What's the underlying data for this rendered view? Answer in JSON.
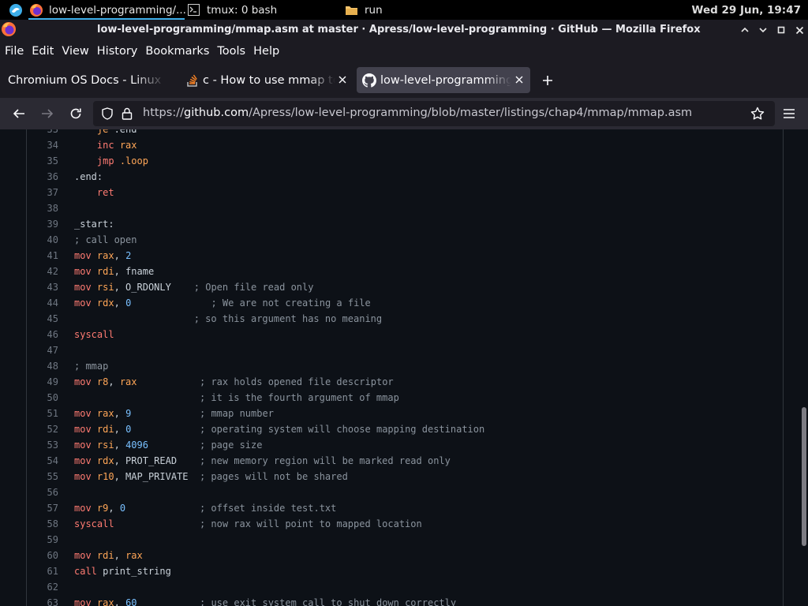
{
  "taskbar": {
    "apps": [
      {
        "label": "low-level-programming/...",
        "icon": "firefox-icon"
      },
      {
        "label": "tmux: 0 bash",
        "icon": "terminal-icon"
      },
      {
        "label": "run",
        "icon": "folder-icon"
      }
    ],
    "clock": "Wed 29 Jun, 19:47"
  },
  "window": {
    "title": "low-level-programming/mmap.asm at master · Apress/low-level-programming · GitHub — Mozilla Firefox"
  },
  "menu": {
    "items": [
      "File",
      "Edit",
      "View",
      "History",
      "Bookmarks",
      "Tools",
      "Help"
    ]
  },
  "tabs": [
    {
      "label": "Chromium OS Docs - Linux System Call Table",
      "icon": "",
      "active": false
    },
    {
      "label": "c - How to use mmap to allocate a memory",
      "icon": "stackoverflow-icon",
      "active": false
    },
    {
      "label": "low-level-programming/mmap.asm",
      "icon": "github-icon",
      "active": true
    }
  ],
  "navbar": {
    "url_prefix": "https://",
    "url_host": "github.com",
    "url_path": "/Apress/low-level-programming/blob/master/listings/chap4/mmap/mmap.asm"
  },
  "code": {
    "lines": [
      {
        "n": "33",
        "tokens": [
          [
            "    ",
            ""
          ],
          [
            "je",
            "ctrl"
          ],
          [
            " .end",
            "id"
          ]
        ]
      },
      {
        "n": "34",
        "tokens": [
          [
            "    ",
            ""
          ],
          [
            "inc",
            "kw"
          ],
          [
            " ",
            ""
          ],
          [
            "rax",
            "reg"
          ]
        ]
      },
      {
        "n": "35",
        "tokens": [
          [
            "    ",
            ""
          ],
          [
            "jmp",
            "kw"
          ],
          [
            " .loop",
            "ctrl"
          ]
        ]
      },
      {
        "n": "36",
        "tokens": [
          [
            ".end:",
            "id"
          ]
        ]
      },
      {
        "n": "37",
        "tokens": [
          [
            "    ",
            ""
          ],
          [
            "ret",
            "kw"
          ]
        ]
      },
      {
        "n": "38",
        "tokens": []
      },
      {
        "n": "39",
        "tokens": [
          [
            "_start:",
            "id"
          ]
        ]
      },
      {
        "n": "40",
        "tokens": [
          [
            "; call open",
            "cm"
          ]
        ]
      },
      {
        "n": "41",
        "tokens": [
          [
            "mov",
            "kw"
          ],
          [
            " ",
            ""
          ],
          [
            "rax",
            "reg"
          ],
          [
            ", ",
            "id"
          ],
          [
            "2",
            "num"
          ]
        ]
      },
      {
        "n": "42",
        "tokens": [
          [
            "mov",
            "kw"
          ],
          [
            " ",
            ""
          ],
          [
            "rdi",
            "reg"
          ],
          [
            ", fname",
            "id"
          ]
        ]
      },
      {
        "n": "43",
        "tokens": [
          [
            "mov",
            "kw"
          ],
          [
            " ",
            ""
          ],
          [
            "rsi",
            "reg"
          ],
          [
            ", O_RDONLY    ",
            "id"
          ],
          [
            "; Open file read only",
            "cm"
          ]
        ]
      },
      {
        "n": "44",
        "tokens": [
          [
            "mov",
            "kw"
          ],
          [
            " ",
            ""
          ],
          [
            "rdx",
            "reg"
          ],
          [
            ", ",
            "id"
          ],
          [
            "0",
            "num"
          ],
          [
            "              ",
            ""
          ],
          [
            "; We are not creating a file",
            "cm"
          ]
        ]
      },
      {
        "n": "45",
        "tokens": [
          [
            "                     ",
            ""
          ],
          [
            "; so this argument has no meaning",
            "cm"
          ]
        ]
      },
      {
        "n": "46",
        "tokens": [
          [
            "syscall",
            "kw"
          ]
        ]
      },
      {
        "n": "47",
        "tokens": []
      },
      {
        "n": "48",
        "tokens": [
          [
            "; mmap",
            "cm"
          ]
        ]
      },
      {
        "n": "49",
        "tokens": [
          [
            "mov",
            "kw"
          ],
          [
            " ",
            ""
          ],
          [
            "r8",
            "reg"
          ],
          [
            ", ",
            "id"
          ],
          [
            "rax",
            "reg"
          ],
          [
            "           ",
            ""
          ],
          [
            "; rax holds opened file descriptor",
            "cm"
          ]
        ]
      },
      {
        "n": "50",
        "tokens": [
          [
            "                      ",
            ""
          ],
          [
            "; it is the fourth argument of mmap",
            "cm"
          ]
        ]
      },
      {
        "n": "51",
        "tokens": [
          [
            "mov",
            "kw"
          ],
          [
            " ",
            ""
          ],
          [
            "rax",
            "reg"
          ],
          [
            ", ",
            "id"
          ],
          [
            "9",
            "num"
          ],
          [
            "            ",
            ""
          ],
          [
            "; mmap number",
            "cm"
          ]
        ]
      },
      {
        "n": "52",
        "tokens": [
          [
            "mov",
            "kw"
          ],
          [
            " ",
            ""
          ],
          [
            "rdi",
            "reg"
          ],
          [
            ", ",
            "id"
          ],
          [
            "0",
            "num"
          ],
          [
            "            ",
            ""
          ],
          [
            "; operating system will choose mapping destination",
            "cm"
          ]
        ]
      },
      {
        "n": "53",
        "tokens": [
          [
            "mov",
            "kw"
          ],
          [
            " ",
            ""
          ],
          [
            "rsi",
            "reg"
          ],
          [
            ", ",
            "id"
          ],
          [
            "4096",
            "num"
          ],
          [
            "         ",
            ""
          ],
          [
            "; page size",
            "cm"
          ]
        ]
      },
      {
        "n": "54",
        "tokens": [
          [
            "mov",
            "kw"
          ],
          [
            " ",
            ""
          ],
          [
            "rdx",
            "reg"
          ],
          [
            ", PROT_READ    ",
            "id"
          ],
          [
            "; new memory region will be marked read only",
            "cm"
          ]
        ]
      },
      {
        "n": "55",
        "tokens": [
          [
            "mov",
            "kw"
          ],
          [
            " ",
            ""
          ],
          [
            "r10",
            "reg"
          ],
          [
            ", MAP_PRIVATE  ",
            "id"
          ],
          [
            "; pages will not be shared",
            "cm"
          ]
        ]
      },
      {
        "n": "56",
        "tokens": []
      },
      {
        "n": "57",
        "tokens": [
          [
            "mov",
            "kw"
          ],
          [
            " ",
            ""
          ],
          [
            "r9",
            "reg"
          ],
          [
            ", ",
            "id"
          ],
          [
            "0",
            "num"
          ],
          [
            "             ",
            ""
          ],
          [
            "; offset inside test.txt",
            "cm"
          ]
        ]
      },
      {
        "n": "58",
        "tokens": [
          [
            "syscall",
            "kw"
          ],
          [
            "               ",
            ""
          ],
          [
            "; now rax will point to mapped location",
            "cm"
          ]
        ]
      },
      {
        "n": "59",
        "tokens": []
      },
      {
        "n": "60",
        "tokens": [
          [
            "mov",
            "kw"
          ],
          [
            " ",
            ""
          ],
          [
            "rdi",
            "reg"
          ],
          [
            ", ",
            "id"
          ],
          [
            "rax",
            "reg"
          ]
        ]
      },
      {
        "n": "61",
        "tokens": [
          [
            "call",
            "kw"
          ],
          [
            " print_string",
            "id"
          ]
        ]
      },
      {
        "n": "62",
        "tokens": []
      },
      {
        "n": "63",
        "tokens": [
          [
            "mov",
            "kw"
          ],
          [
            " ",
            ""
          ],
          [
            "rax",
            "reg"
          ],
          [
            ", ",
            "id"
          ],
          [
            "60",
            "num"
          ],
          [
            "           ",
            ""
          ],
          [
            "; use exit system call to shut down correctly",
            "cm"
          ]
        ]
      }
    ]
  }
}
